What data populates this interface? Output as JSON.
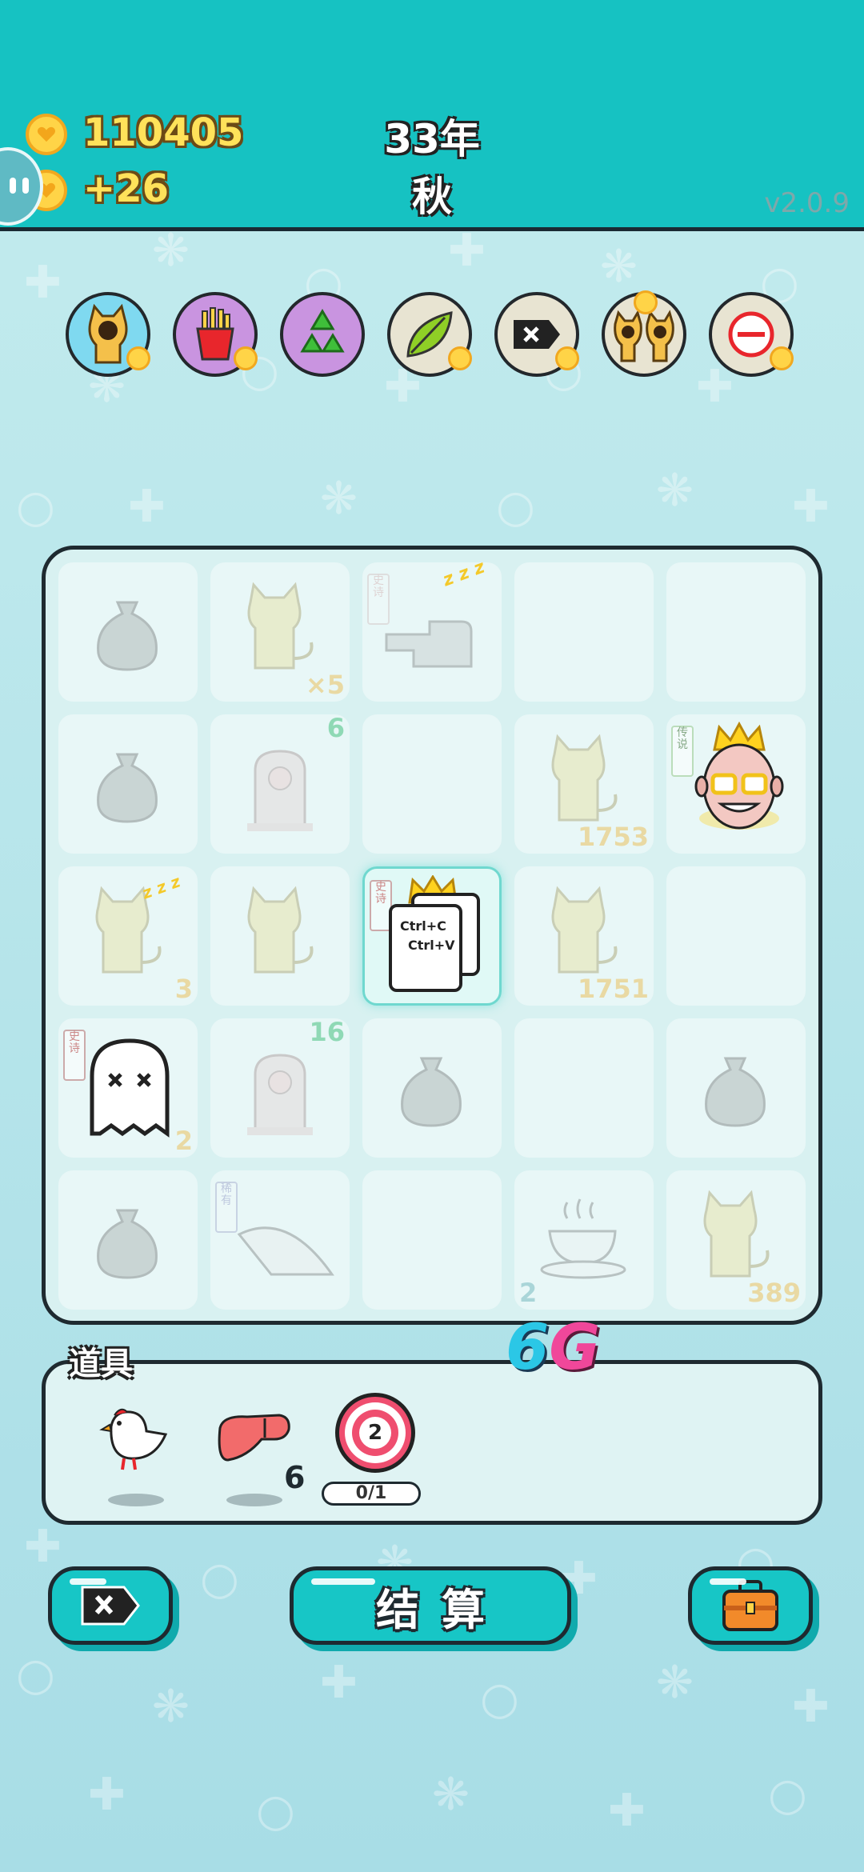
{
  "hud": {
    "coins": "110405",
    "income": "+26",
    "year": "33年",
    "season": "秋",
    "version": "v2.0.9"
  },
  "buffs": [
    {
      "icon": "cat-portrait-icon",
      "bg": "#7fd9f0"
    },
    {
      "icon": "fries-icon",
      "bg": "#c994e0"
    },
    {
      "icon": "recycle-icon",
      "bg": "#c994e0"
    },
    {
      "icon": "leaf-icon",
      "bg": "#e8e4d2"
    },
    {
      "icon": "delete-tag-icon",
      "bg": "#e8e4d2"
    },
    {
      "icon": "twin-cats-icon",
      "bg": "#e8e4d2"
    },
    {
      "icon": "minus-circle-icon",
      "bg": "#e8e4d2"
    }
  ],
  "board": {
    "cells": [
      {
        "icon": "sack-icon",
        "count": ""
      },
      {
        "icon": "cat-icon",
        "count": "×5"
      },
      {
        "icon": "hand-icon",
        "count": "",
        "tag": "史诗"
      },
      {
        "icon": "",
        "count": ""
      },
      {
        "icon": "",
        "count": ""
      },
      {
        "icon": "sack-icon",
        "count": ""
      },
      {
        "icon": "pig-tombstone-icon",
        "count": "6"
      },
      {
        "icon": "",
        "count": ""
      },
      {
        "icon": "cat-icon",
        "count": "1753"
      },
      {
        "icon": "king-face-icon",
        "count": "",
        "tag": "传说"
      },
      {
        "icon": "cat-icon",
        "count": "3"
      },
      {
        "icon": "cat-icon",
        "count": ""
      },
      {
        "icon": "copy-paste-icon",
        "count": "",
        "tag": "史诗"
      },
      {
        "icon": "cat-icon",
        "count": "1751"
      },
      {
        "icon": "",
        "count": ""
      },
      {
        "icon": "ghost-icon",
        "count": "2",
        "tag": "史诗"
      },
      {
        "icon": "pig-tombstone-icon",
        "count": "16"
      },
      {
        "icon": "sack-icon",
        "count": ""
      },
      {
        "icon": "",
        "count": ""
      },
      {
        "icon": "sack-icon",
        "count": ""
      },
      {
        "icon": "sack-icon",
        "count": ""
      },
      {
        "icon": "fan-icon",
        "count": "",
        "tag": "稀有"
      },
      {
        "icon": "",
        "count": ""
      },
      {
        "icon": "teacup-icon",
        "count": "2"
      },
      {
        "icon": "cat-icon",
        "count": "389"
      }
    ],
    "copy_text_1": "Ctrl+C",
    "copy_text_2": "Ctrl+V",
    "zzz": "z z z"
  },
  "items_panel": {
    "title": "道具",
    "network_badge_1": "6",
    "network_badge_2": "G",
    "items": [
      {
        "icon": "bird-icon",
        "count": ""
      },
      {
        "icon": "liver-icon",
        "count": "6"
      },
      {
        "icon": "target-icon",
        "number": "2",
        "progress": "0/1"
      }
    ]
  },
  "buttons": {
    "discard": "delete-tag-icon",
    "settle": "结算",
    "bag": "briefcase-icon"
  },
  "colors": {
    "header": "#16c2c2",
    "coin_text": "#ffe25a",
    "button": "#17c6c6",
    "board": "#d8f1f1"
  }
}
